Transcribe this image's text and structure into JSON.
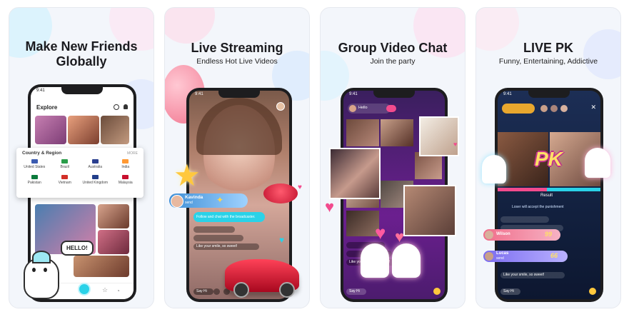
{
  "cards": [
    {
      "title_line1": "Make New Friends",
      "title_line2": "Globally",
      "phone": {
        "time": "9:41",
        "screen_title": "Explore",
        "region_label": "Country & Region",
        "more_label": "MORE",
        "countries": [
          "United States",
          "Brazil",
          "Australia",
          "India",
          "Pakistan",
          "Vietnam",
          "United Kingdom",
          "Malaysia"
        ],
        "mascot_bubble": "HELLO!"
      }
    },
    {
      "title": "Live Streaming",
      "subtitle": "Endless Hot Live Videos",
      "phone": {
        "time": "9:41",
        "host_name": "Kavinda",
        "host_sub": "send",
        "follow_text": "Follow and chat with the broadcaster.",
        "comment_placeholder": "Say Hi",
        "comment_text": "Like your smile, so sweet!"
      }
    },
    {
      "title": "Group Video Chat",
      "subtitle": "Join the party",
      "phone": {
        "time": "9:41",
        "room_name": "Hello",
        "comment_placeholder": "Say Hi",
        "comment_text": "Like your smile, so sweet!"
      }
    },
    {
      "title": "LIVE PK",
      "subtitle": "Funny, Entertaining, Addictive",
      "phone": {
        "time": "9:41",
        "pk_label": "PK",
        "result_label": "Result",
        "punishment_text": "Loser will accept the punishment",
        "user1_name": "Lucas",
        "user1_sub": "send",
        "user1_count": "66",
        "user2_name": "Wilson",
        "user2_count": "99",
        "comment_placeholder": "Say Hi",
        "comment_text": "Like your smile, so sweet!"
      }
    }
  ],
  "colors": {
    "accent_cyan": "#2ad2e8",
    "accent_pink": "#f24b8d",
    "purple_room": "#6b1f8f",
    "dark_pk": "#12203e"
  }
}
